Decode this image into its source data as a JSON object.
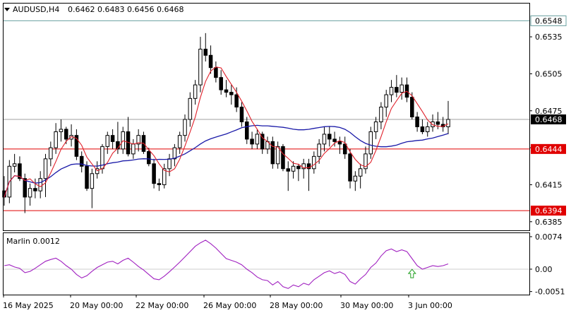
{
  "header": {
    "symbol": "AUDUSD,H4",
    "ohlc": "0.6462 0.6483 0.6456 0.6468"
  },
  "colors": {
    "background": "#ffffff",
    "frame": "#000000",
    "bull_body": "#ffffff",
    "bear_body": "#000000",
    "fast_ma": "#e0202a",
    "slow_ma": "#1a1aa8",
    "oscillator": "#a020c0",
    "level_line": "#e00000",
    "top_level_line": "#6aa0a0",
    "current_price_line": "#a0a0a0",
    "up_arrow": "#22a022"
  },
  "chart_data": {
    "type": "candlestick",
    "y_range": [
      0.6378,
      0.6562
    ],
    "y_ticks": [
      "0.6535",
      "0.6505",
      "0.6475",
      "0.6445",
      "0.6415",
      "0.6385"
    ],
    "x_ticks": [
      "16 May 2025",
      "20 May 00:00",
      "22 May 00:00",
      "26 May 00:00",
      "28 May 00:00",
      "30 May 00:00",
      "3 Jun 00:00"
    ],
    "price_labels": {
      "top_level": "0.6548",
      "current": "0.6468",
      "level_1": "0.6444",
      "level_2": "0.6394"
    },
    "levels": {
      "top": 0.6548,
      "current": 0.6468,
      "level_1": 0.6444,
      "level_2": 0.6394
    },
    "candles": [
      [
        0.641,
        0.6422,
        0.6398,
        0.6405
      ],
      [
        0.6405,
        0.6435,
        0.64,
        0.643
      ],
      [
        0.643,
        0.644,
        0.6425,
        0.6432
      ],
      [
        0.6432,
        0.6438,
        0.6418,
        0.642
      ],
      [
        0.642,
        0.6424,
        0.6392,
        0.6405
      ],
      [
        0.6405,
        0.6416,
        0.6398,
        0.6412
      ],
      [
        0.6412,
        0.642,
        0.6404,
        0.641
      ],
      [
        0.641,
        0.6426,
        0.6404,
        0.642
      ],
      [
        0.642,
        0.644,
        0.6405,
        0.6436
      ],
      [
        0.6436,
        0.645,
        0.643,
        0.6445
      ],
      [
        0.6445,
        0.6465,
        0.644,
        0.6458
      ],
      [
        0.6458,
        0.6468,
        0.645,
        0.646
      ],
      [
        0.646,
        0.6462,
        0.6448,
        0.6452
      ],
      [
        0.6452,
        0.6464,
        0.6446,
        0.6455
      ],
      [
        0.6455,
        0.646,
        0.6435,
        0.6438
      ],
      [
        0.6438,
        0.6442,
        0.6425,
        0.643
      ],
      [
        0.643,
        0.6434,
        0.641,
        0.6412
      ],
      [
        0.6412,
        0.6428,
        0.6396,
        0.6424
      ],
      [
        0.6424,
        0.6434,
        0.642,
        0.6428
      ],
      [
        0.6428,
        0.6448,
        0.6424,
        0.6446
      ],
      [
        0.6446,
        0.6458,
        0.644,
        0.6455
      ],
      [
        0.6455,
        0.646,
        0.6444,
        0.645
      ],
      [
        0.645,
        0.6466,
        0.644,
        0.6444
      ],
      [
        0.6444,
        0.6462,
        0.644,
        0.6458
      ],
      [
        0.6458,
        0.647,
        0.6438,
        0.644
      ],
      [
        0.644,
        0.6452,
        0.6436,
        0.6448
      ],
      [
        0.6448,
        0.646,
        0.6442,
        0.6455
      ],
      [
        0.6455,
        0.6458,
        0.644,
        0.6442
      ],
      [
        0.6442,
        0.6445,
        0.643,
        0.6432
      ],
      [
        0.6432,
        0.6436,
        0.6412,
        0.6416
      ],
      [
        0.6416,
        0.642,
        0.641,
        0.6415
      ],
      [
        0.6415,
        0.6432,
        0.6412,
        0.6428
      ],
      [
        0.6428,
        0.644,
        0.6422,
        0.6436
      ],
      [
        0.6436,
        0.6448,
        0.643,
        0.6445
      ],
      [
        0.6445,
        0.6458,
        0.644,
        0.6455
      ],
      [
        0.6455,
        0.6472,
        0.645,
        0.6468
      ],
      [
        0.6468,
        0.649,
        0.6462,
        0.6485
      ],
      [
        0.6485,
        0.65,
        0.648,
        0.6496
      ],
      [
        0.6496,
        0.6535,
        0.649,
        0.6525
      ],
      [
        0.6525,
        0.6538,
        0.6515,
        0.652
      ],
      [
        0.652,
        0.6528,
        0.6505,
        0.651
      ],
      [
        0.651,
        0.6515,
        0.6498,
        0.6502
      ],
      [
        0.6502,
        0.6508,
        0.6488,
        0.6492
      ],
      [
        0.6492,
        0.65,
        0.6486,
        0.649
      ],
      [
        0.649,
        0.6496,
        0.648,
        0.6488
      ],
      [
        0.6488,
        0.6494,
        0.6474,
        0.6478
      ],
      [
        0.6478,
        0.6482,
        0.6462,
        0.6466
      ],
      [
        0.6466,
        0.647,
        0.6448,
        0.6452
      ],
      [
        0.6452,
        0.6458,
        0.6444,
        0.6448
      ],
      [
        0.6448,
        0.646,
        0.6444,
        0.6456
      ],
      [
        0.6456,
        0.6458,
        0.644,
        0.6444
      ],
      [
        0.6444,
        0.6454,
        0.644,
        0.645
      ],
      [
        0.645,
        0.6454,
        0.6428,
        0.6432
      ],
      [
        0.6432,
        0.645,
        0.6428,
        0.6446
      ],
      [
        0.6446,
        0.6448,
        0.6426,
        0.6428
      ],
      [
        0.6428,
        0.6434,
        0.641,
        0.6426
      ],
      [
        0.6426,
        0.6434,
        0.642,
        0.643
      ],
      [
        0.643,
        0.6432,
        0.6418,
        0.6428
      ],
      [
        0.6428,
        0.6436,
        0.642,
        0.6432
      ],
      [
        0.6432,
        0.6436,
        0.641,
        0.6428
      ],
      [
        0.6428,
        0.6442,
        0.6424,
        0.6438
      ],
      [
        0.6438,
        0.6452,
        0.6432,
        0.6448
      ],
      [
        0.6448,
        0.6462,
        0.6442,
        0.6456
      ],
      [
        0.6456,
        0.6462,
        0.6446,
        0.6452
      ],
      [
        0.6452,
        0.6458,
        0.6446,
        0.645
      ],
      [
        0.645,
        0.6454,
        0.644,
        0.6448
      ],
      [
        0.6448,
        0.6454,
        0.6436,
        0.644
      ],
      [
        0.644,
        0.6444,
        0.6412,
        0.6418
      ],
      [
        0.6418,
        0.6426,
        0.641,
        0.6422
      ],
      [
        0.6422,
        0.6432,
        0.6412,
        0.6428
      ],
      [
        0.6428,
        0.6446,
        0.6424,
        0.644
      ],
      [
        0.644,
        0.6462,
        0.6436,
        0.6458
      ],
      [
        0.6458,
        0.647,
        0.6452,
        0.6466
      ],
      [
        0.6466,
        0.6482,
        0.646,
        0.6478
      ],
      [
        0.6478,
        0.6492,
        0.647,
        0.6488
      ],
      [
        0.6488,
        0.65,
        0.6482,
        0.6494
      ],
      [
        0.6494,
        0.6504,
        0.6486,
        0.649
      ],
      [
        0.649,
        0.6502,
        0.6484,
        0.6496
      ],
      [
        0.6496,
        0.6502,
        0.6482,
        0.6486
      ],
      [
        0.6486,
        0.649,
        0.6468,
        0.647
      ],
      [
        0.647,
        0.6474,
        0.6458,
        0.6462
      ],
      [
        0.6462,
        0.6468,
        0.6456,
        0.6458
      ],
      [
        0.6458,
        0.6466,
        0.6454,
        0.6462
      ],
      [
        0.6462,
        0.6472,
        0.6458,
        0.6466
      ],
      [
        0.6466,
        0.6474,
        0.646,
        0.6464
      ],
      [
        0.6464,
        0.647,
        0.6458,
        0.6462
      ],
      [
        0.6462,
        0.6483,
        0.6456,
        0.6468
      ]
    ],
    "indicator": {
      "name": "Marlin 0.0012",
      "y_range": [
        -0.0058,
        0.0082
      ],
      "y_ticks": [
        "0.0074",
        "0.00",
        "-0.0051"
      ],
      "values": [
        0.0008,
        0.001,
        0.0005,
        0.0002,
        -0.0008,
        -0.0005,
        0.0002,
        0.001,
        0.0018,
        0.0022,
        0.0025,
        0.0018,
        0.0008,
        0.0,
        -0.0012,
        -0.002,
        -0.0015,
        -0.0005,
        0.0004,
        0.001,
        0.0016,
        0.0018,
        0.0012,
        0.002,
        0.0025,
        0.0016,
        0.0006,
        -0.0002,
        -0.0012,
        -0.0022,
        -0.0024,
        -0.0016,
        -0.0006,
        0.0005,
        0.0016,
        0.0028,
        0.004,
        0.0052,
        0.006,
        0.0066,
        0.0058,
        0.0048,
        0.0036,
        0.0024,
        0.002,
        0.0016,
        0.001,
        0.0,
        -0.0008,
        -0.0018,
        -0.0024,
        -0.0026,
        -0.0036,
        -0.0028,
        -0.004,
        -0.0044,
        -0.0036,
        -0.004,
        -0.0032,
        -0.0036,
        -0.0024,
        -0.0016,
        -0.0008,
        -0.0004,
        -0.001,
        -0.0006,
        -0.0012,
        -0.0028,
        -0.0034,
        -0.0022,
        -0.0012,
        0.0004,
        0.0014,
        0.003,
        0.0042,
        0.0046,
        0.004,
        0.0044,
        0.004,
        0.0024,
        0.0008,
        0.0,
        0.0004,
        0.0008,
        0.0006,
        0.0008,
        0.0012
      ]
    }
  }
}
